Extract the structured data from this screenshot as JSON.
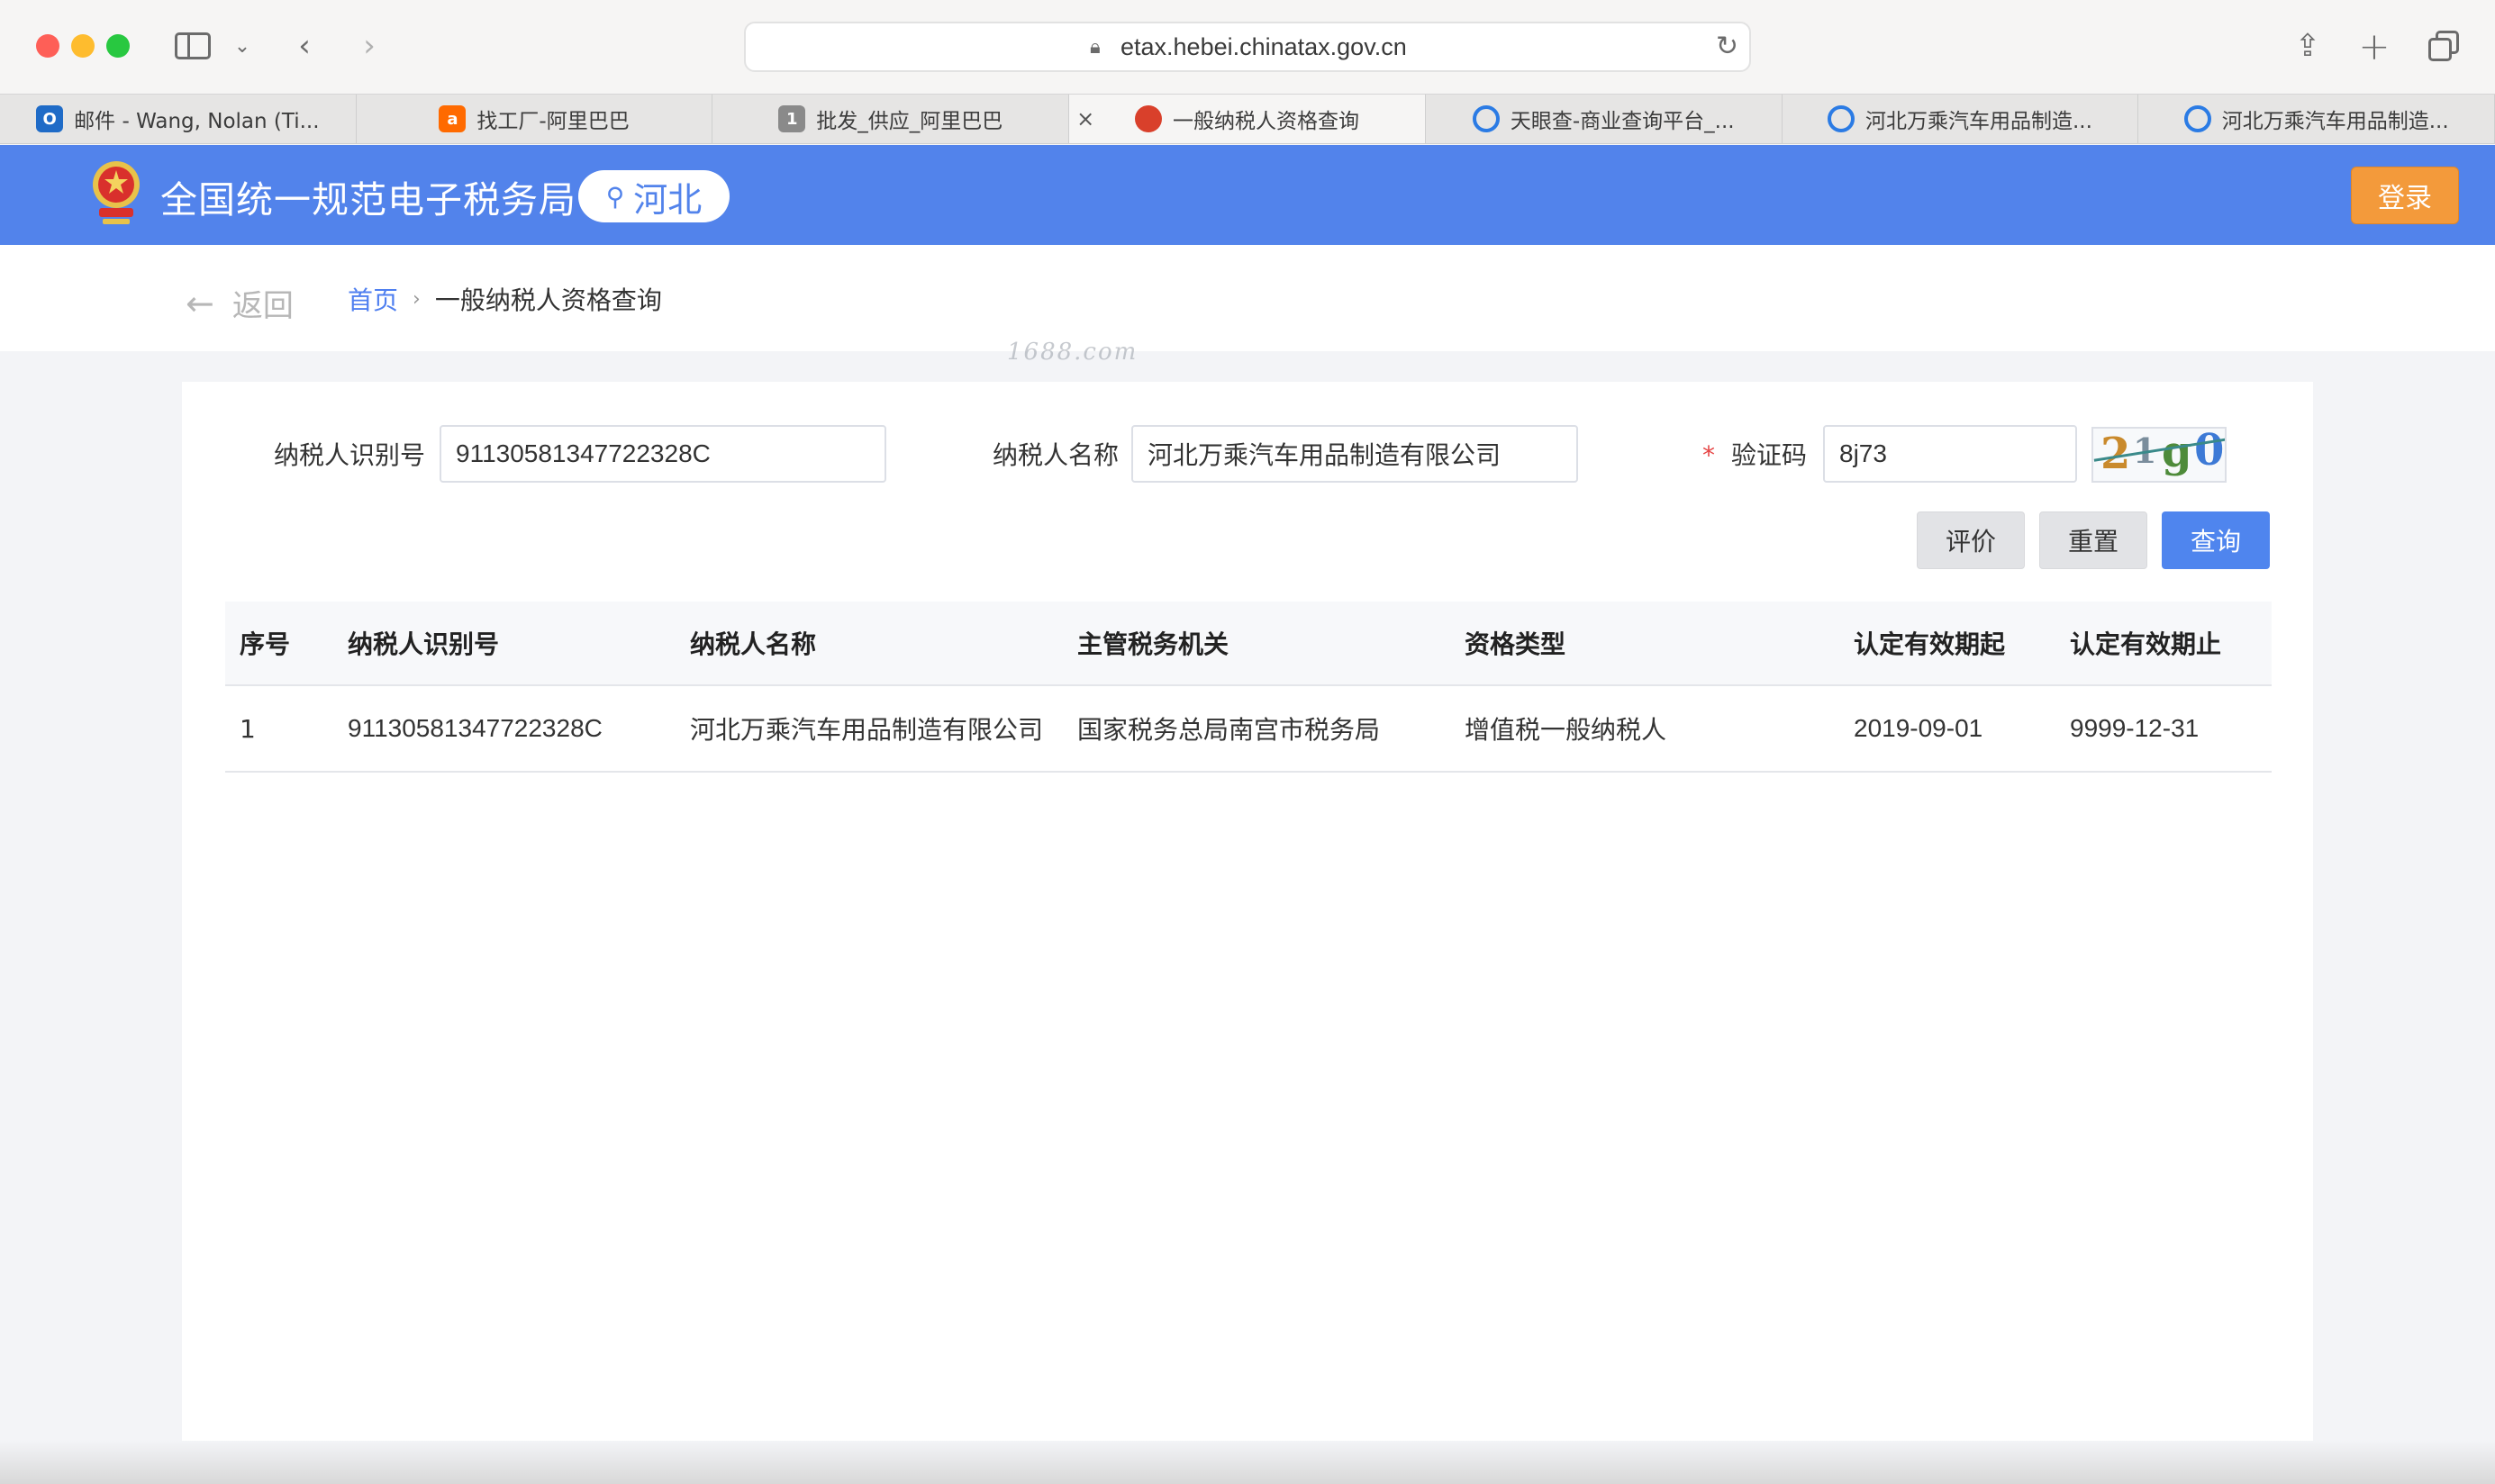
{
  "browser": {
    "url": "etax.hebei.chinatax.gov.cn",
    "tabs": [
      {
        "label": "邮件 - Wang, Nolan (Ti...",
        "icon": "outlook-icon"
      },
      {
        "label": "找工厂-阿里巴巴",
        "icon": "alibaba-icon"
      },
      {
        "label": "批发_供应_阿里巴巴",
        "icon": "number-1-icon",
        "badge": "1"
      },
      {
        "label": "一般纳税人资格查询",
        "icon": "tax-emblem-icon",
        "active": true
      },
      {
        "label": "天眼查-商业查询平台_...",
        "icon": "tianyancha-icon"
      },
      {
        "label": "河北万乘汽车用品制造...",
        "icon": "tianyancha-icon"
      },
      {
        "label": "河北万乘汽车用品制造...",
        "icon": "tianyancha-icon"
      }
    ]
  },
  "header": {
    "title": "全国统一规范电子税务局",
    "province": "河北",
    "login": "登录",
    "brand_color": "#5283eb"
  },
  "nav": {
    "back": "返回",
    "breadcrumb_home": "首页",
    "breadcrumb_current": "一般纳税人资格查询"
  },
  "form": {
    "taxpayer_id_label": "纳税人识别号",
    "taxpayer_id_value": "91130581347722328C",
    "taxpayer_name_label": "纳税人名称",
    "taxpayer_name_value": "河北万乘汽车用品制造有限公司",
    "captcha_label": "验证码",
    "captcha_required": "*",
    "captcha_value": "8j73",
    "captcha_image_text": [
      "2",
      "1",
      "g",
      "0"
    ]
  },
  "buttons": {
    "evaluate": "评价",
    "reset": "重置",
    "query": "查询"
  },
  "table": {
    "headers": [
      "序号",
      "纳税人识别号",
      "纳税人名称",
      "主管税务机关",
      "资格类型",
      "认定有效期起",
      "认定有效期止"
    ],
    "rows": [
      [
        "1",
        "91130581347722328C",
        "河北万乘汽车用品制造有限公司",
        "国家税务总局南宫市税务局",
        "增值税一般纳税人",
        "2019-09-01",
        "9999-12-31"
      ]
    ]
  },
  "watermark": "1688.com"
}
